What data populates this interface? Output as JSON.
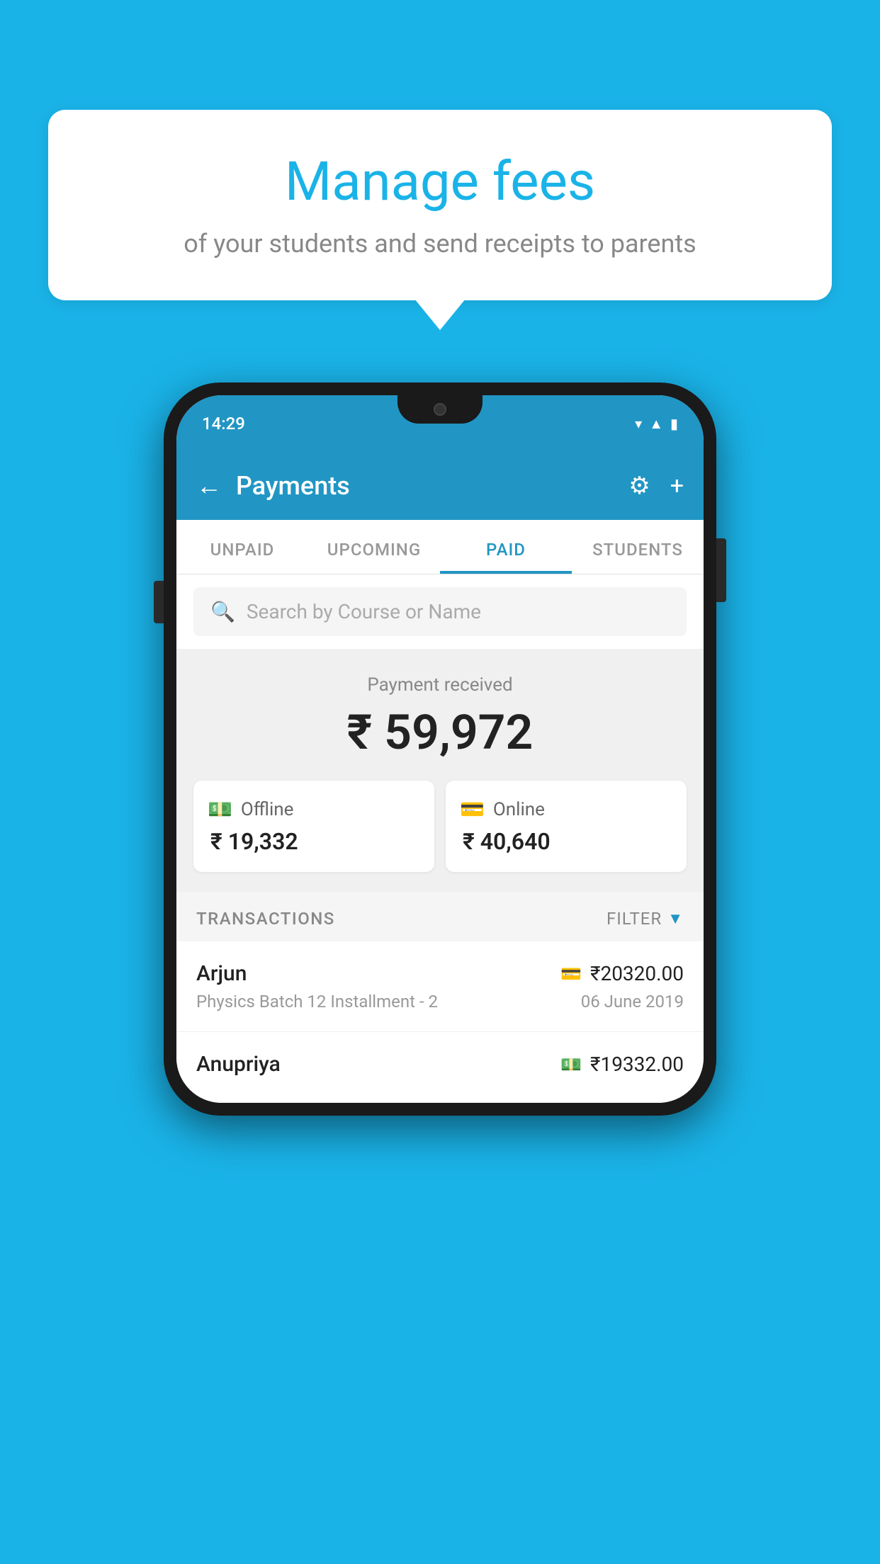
{
  "background_color": "#1ab3e8",
  "speech_bubble": {
    "title": "Manage fees",
    "subtitle": "of your students and send receipts to parents"
  },
  "phone": {
    "status_bar": {
      "time": "14:29",
      "icons": [
        "wifi",
        "signal",
        "battery"
      ]
    },
    "app_bar": {
      "back_label": "←",
      "title": "Payments",
      "gear_icon": "⚙",
      "plus_icon": "+"
    },
    "tabs": [
      {
        "label": "UNPAID",
        "active": false
      },
      {
        "label": "UPCOMING",
        "active": false
      },
      {
        "label": "PAID",
        "active": true
      },
      {
        "label": "STUDENTS",
        "active": false
      }
    ],
    "search": {
      "placeholder": "Search by Course or Name"
    },
    "payment_summary": {
      "label": "Payment received",
      "amount": "₹ 59,972",
      "offline": {
        "label": "Offline",
        "amount": "₹ 19,332"
      },
      "online": {
        "label": "Online",
        "amount": "₹ 40,640"
      }
    },
    "transactions": {
      "section_label": "TRANSACTIONS",
      "filter_label": "FILTER",
      "items": [
        {
          "name": "Arjun",
          "course": "Physics Batch 12 Installment - 2",
          "amount": "₹20320.00",
          "date": "06 June 2019",
          "icon_type": "card"
        },
        {
          "name": "Anupriya",
          "course": "",
          "amount": "₹19332.00",
          "date": "",
          "icon_type": "cash"
        }
      ]
    }
  }
}
